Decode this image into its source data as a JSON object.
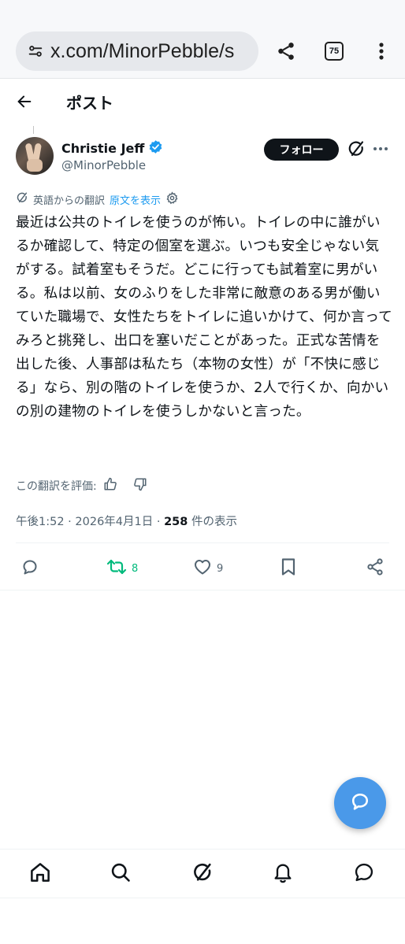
{
  "browser": {
    "url": "x.com/MinorPebble/s",
    "tab_count": "75"
  },
  "header": {
    "title": "ポスト"
  },
  "post": {
    "display_name": "Christie Jeff",
    "handle": "@MinorPebble",
    "follow_label": "フォロー",
    "translated_from": "英語からの翻訳",
    "show_original": "原文を表示",
    "text": "最近は公共のトイレを使うのが怖い。トイレの中に誰がいるか確認して、特定の個室を選ぶ。いつも安全じゃない気がする。試着室もそうだ。どこに行っても試着室に男がいる。私は以前、女のふりをした非常に敵意のある男が働いていた職場で、女性たちをトイレに追いかけて、何か言ってみろと挑発し、出口を塞いだことがあった。正式な苦情を出した後、人事部は私たち（本物の女性）が「不快に感じる」なら、別の階のトイレを使うか、2人で行くか、向かいの別の建物のトイレを使うしかないと言った。",
    "rate_translation": "この翻訳を評価:",
    "time": "午後1:52",
    "sep1": "·",
    "date": "2026年4月1日",
    "sep2": "·",
    "views_count": "258",
    "views_label": "件の表示",
    "retweets": "8",
    "likes": "9"
  },
  "icons": {
    "tune": "tune-icon",
    "share": "share-icon",
    "more": "more-vertical-icon",
    "back": "back-arrow-icon",
    "verified": "verified-badge-icon",
    "grok": "grok-icon",
    "reply": "reply-icon",
    "retweet": "retweet-icon",
    "like": "heart-icon",
    "bookmark": "bookmark-icon",
    "home": "home-icon",
    "search": "search-icon",
    "bell": "bell-icon",
    "messages": "messages-icon"
  },
  "colors": {
    "accent": "#1d9bf0",
    "retweet_green": "#00ba7c",
    "fab_blue": "#4a99e9",
    "text": "#0f1419",
    "muted": "#536471"
  }
}
